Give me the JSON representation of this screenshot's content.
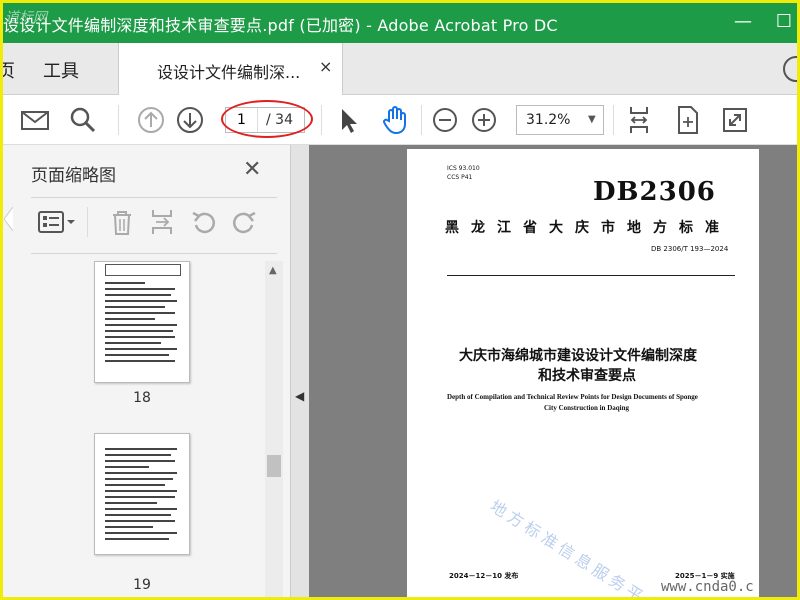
{
  "window": {
    "title": "设设计文件编制深度和技术审查要点.pdf (已加密) - Adobe Acrobat Pro DC",
    "watermark": "道标网",
    "minimize_glyph": "—",
    "maximize_glyph": "☐"
  },
  "tabbar": {
    "home_label": "页",
    "tools_label": "工具",
    "doc_tab_label": "设设计文件编制深...",
    "close_glyph": "×"
  },
  "toolbar": {
    "current_page": "1",
    "total_pages": "/ 34",
    "zoom": "31.2%",
    "zoom_caret": "▼"
  },
  "thumbnails_panel": {
    "title": "页面缩略图",
    "close_glyph": "✕",
    "scroll_up_glyph": "▲",
    "pages": [
      {
        "label": "18"
      },
      {
        "label": "19"
      }
    ]
  },
  "document": {
    "collapse_glyph": "◀",
    "ics": "ICS 93.010",
    "ccs": "CCS P41",
    "code": "DB2306",
    "standard_title": "黑龙江省大庆市地方标准",
    "standard_number": "DB 2306/T 193—2024",
    "title_cn_line1": "大庆市海绵城市建设设计文件编制深度",
    "title_cn_line2": "和技术审查要点",
    "title_en_line1": "Depth of Compilation and Technical Review Points for Design Documents of Sponge",
    "title_en_line2": "City Construction in Daqing",
    "watermark": "地方标准信息服务平台",
    "issue_date": "2024－12－10 发布",
    "implement_date": "2025－1－9 实施",
    "site_mark": "www.cnda0.c"
  },
  "colors": {
    "titlebar": "#1d9b47",
    "outer_border": "#f0ec0a",
    "annotation_ellipse": "#e02020",
    "hand_tool_active": "#1473e6"
  }
}
